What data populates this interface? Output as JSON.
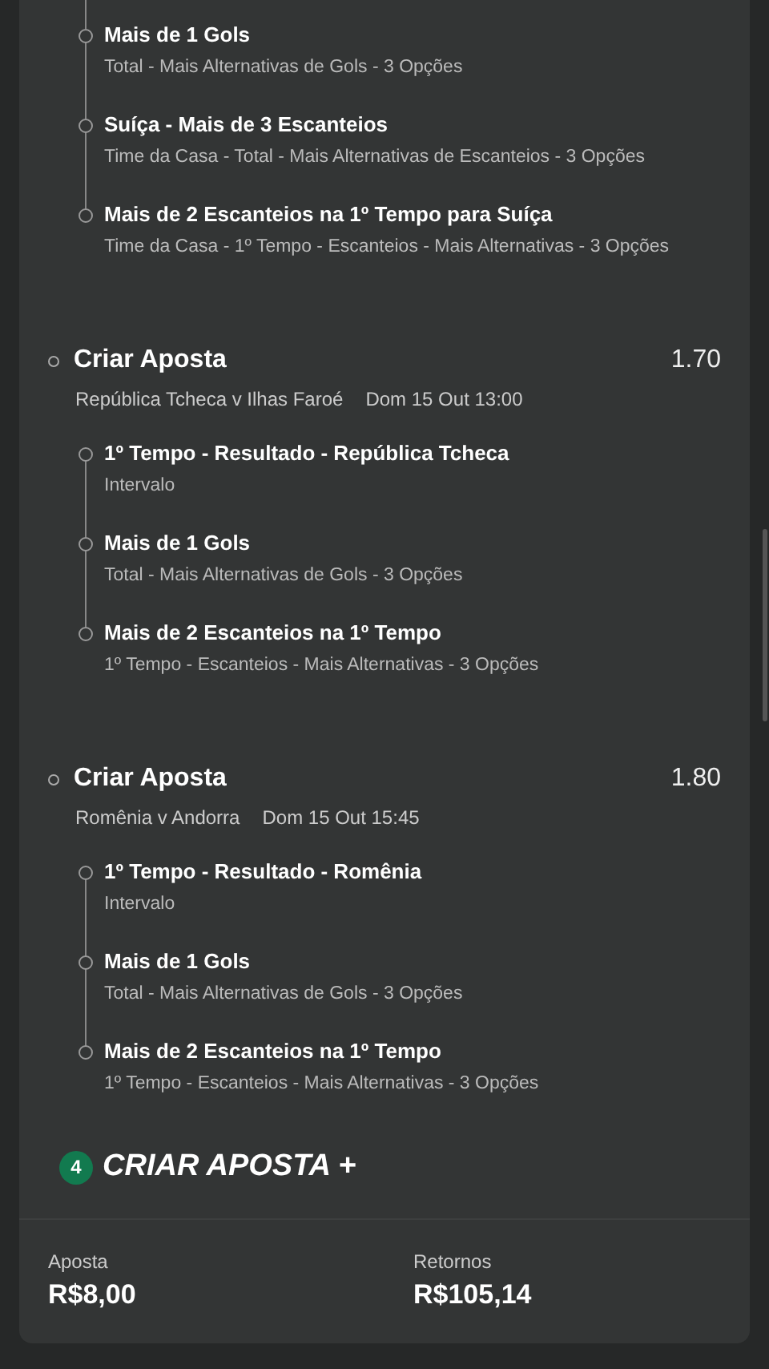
{
  "bets": [
    {
      "legs": [
        {
          "title": "Mais de 1 Gols",
          "detail": "Total - Mais Alternativas de Gols - 3 Opções"
        },
        {
          "title": "Suíça - Mais de 3 Escanteios",
          "detail": "Time da Casa - Total - Mais Alternativas de Escanteios - 3 Opções"
        },
        {
          "title": "Mais de 2 Escanteios na 1º Tempo para Suíça",
          "detail": "Time da Casa - 1º Tempo - Escanteios - Mais Alternativas - 3 Opções"
        }
      ]
    },
    {
      "title": "Criar Aposta",
      "odds": "1.70",
      "match": "República Tcheca v Ilhas Faroé",
      "time": "Dom 15 Out 13:00",
      "legs": [
        {
          "title": "1º Tempo - Resultado - República Tcheca",
          "detail": "Intervalo"
        },
        {
          "title": "Mais de 1 Gols",
          "detail": "Total - Mais Alternativas de Gols - 3 Opções"
        },
        {
          "title": "Mais de 2 Escanteios na 1º Tempo",
          "detail": "1º Tempo - Escanteios - Mais Alternativas - 3 Opções"
        }
      ]
    },
    {
      "title": "Criar Aposta",
      "odds": "1.80",
      "match": "Romênia v Andorra",
      "time": "Dom 15 Out 15:45",
      "legs": [
        {
          "title": "1º Tempo - Resultado - Romênia",
          "detail": "Intervalo"
        },
        {
          "title": "Mais de 1 Gols",
          "detail": "Total - Mais Alternativas de Gols - 3 Opções"
        },
        {
          "title": "Mais de 2 Escanteios na 1º Tempo",
          "detail": "1º Tempo - Escanteios - Mais Alternativas - 3 Opções"
        }
      ]
    }
  ],
  "create_bet": {
    "count": "4",
    "label": "CRIAR APOSTA +"
  },
  "summary": [
    {
      "label": "Aposta",
      "value": "R$8,00"
    },
    {
      "label": "Retornos",
      "value": "R$105,14"
    }
  ]
}
